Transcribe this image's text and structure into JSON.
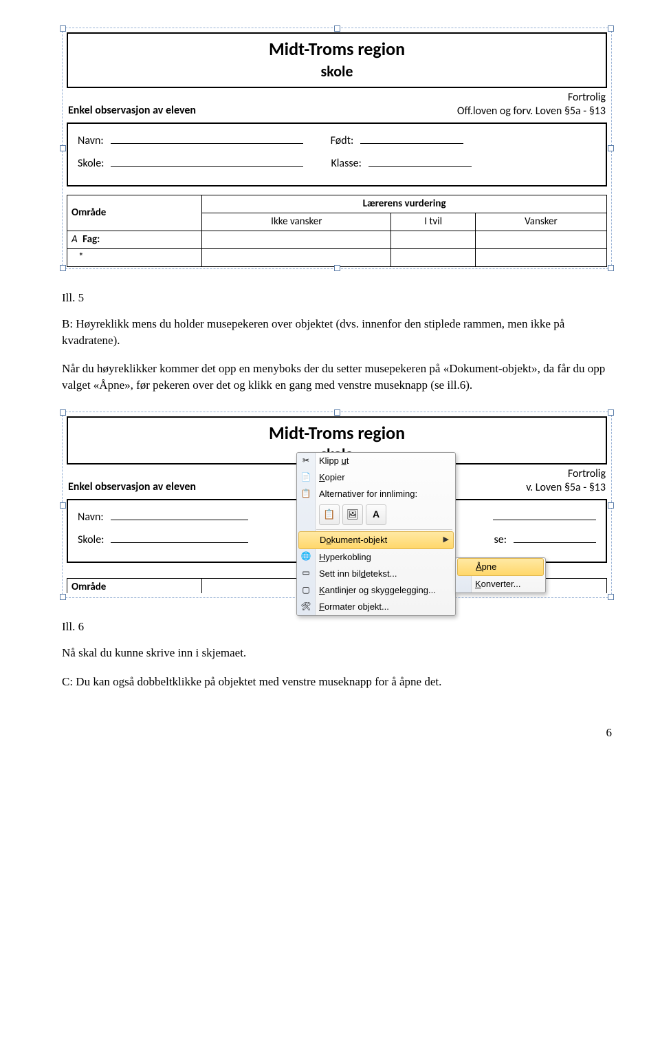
{
  "form": {
    "title_line1": "Midt-Troms region",
    "title_line2": "skole",
    "confidential": "Fortrolig",
    "legal": "Off.loven og forv. Loven §5a - §13",
    "subheading": "Enkel observasjon av eleven",
    "labels": {
      "navn": "Navn:",
      "fodt": "Født:",
      "skole": "Skole:",
      "klasse": "Klasse:",
      "klasse_short": "se:"
    },
    "col_area": "Område",
    "col_eval": "Lærerens vurdering",
    "eval_cols": {
      "none": "Ikke vansker",
      "doubt": "I tvil",
      "diff": "Vansker"
    },
    "row_label_prefix": "A",
    "row_label": "Fag:",
    "area_partial": "Område",
    "eval_partial": "rens vurdering"
  },
  "body": {
    "caption5": "Ill. 5",
    "para1": "B: Høyreklikk mens du holder musepekeren over  objektet  (dvs.  innenfor den stiplede rammen, men ikke på kvadratene).",
    "para2": "Når du høyreklikker kommer det opp en menyboks der du  setter musepekeren på «Dokument-objekt», da får du opp valget «Åpne», før pekeren over det  og klikk en gang med venstre museknapp (se ill.6).",
    "caption6": "Ill. 6",
    "para3": "Nå skal du kunne skrive inn i skjemaet.",
    "para4": "C: Du kan også dobbeltklikke på objektet med venstre museknapp for å åpne det."
  },
  "menu": {
    "cut": "Klipp ut",
    "cut_u": "u",
    "copy": "Kopier",
    "copy_u": "K",
    "paste_label": "Alternativer for innliming:",
    "opt_A": "A",
    "doc_object": "Dokument-objekt",
    "doc_u": "o",
    "hyperlink": "Hyperkobling",
    "hyper_u": "d",
    "caption_item": "Sett inn bildetekst...",
    "caption_u": "d",
    "borders": "Kantlinjer og skyggelegging...",
    "borders_u": "K",
    "format": "Formater objekt...",
    "format_u": "F",
    "open": "Åpne",
    "open_u": "Å",
    "convert": "Konverter...",
    "convert_u": "K"
  },
  "icons": {
    "cut": "✂",
    "copy": "📄",
    "paste": "📋",
    "clipboard1": "📋",
    "clipboard2": "🖼",
    "globe": "🌐",
    "frame": "▭",
    "page": "▢",
    "wrench": "🛠"
  },
  "page_number": "6"
}
